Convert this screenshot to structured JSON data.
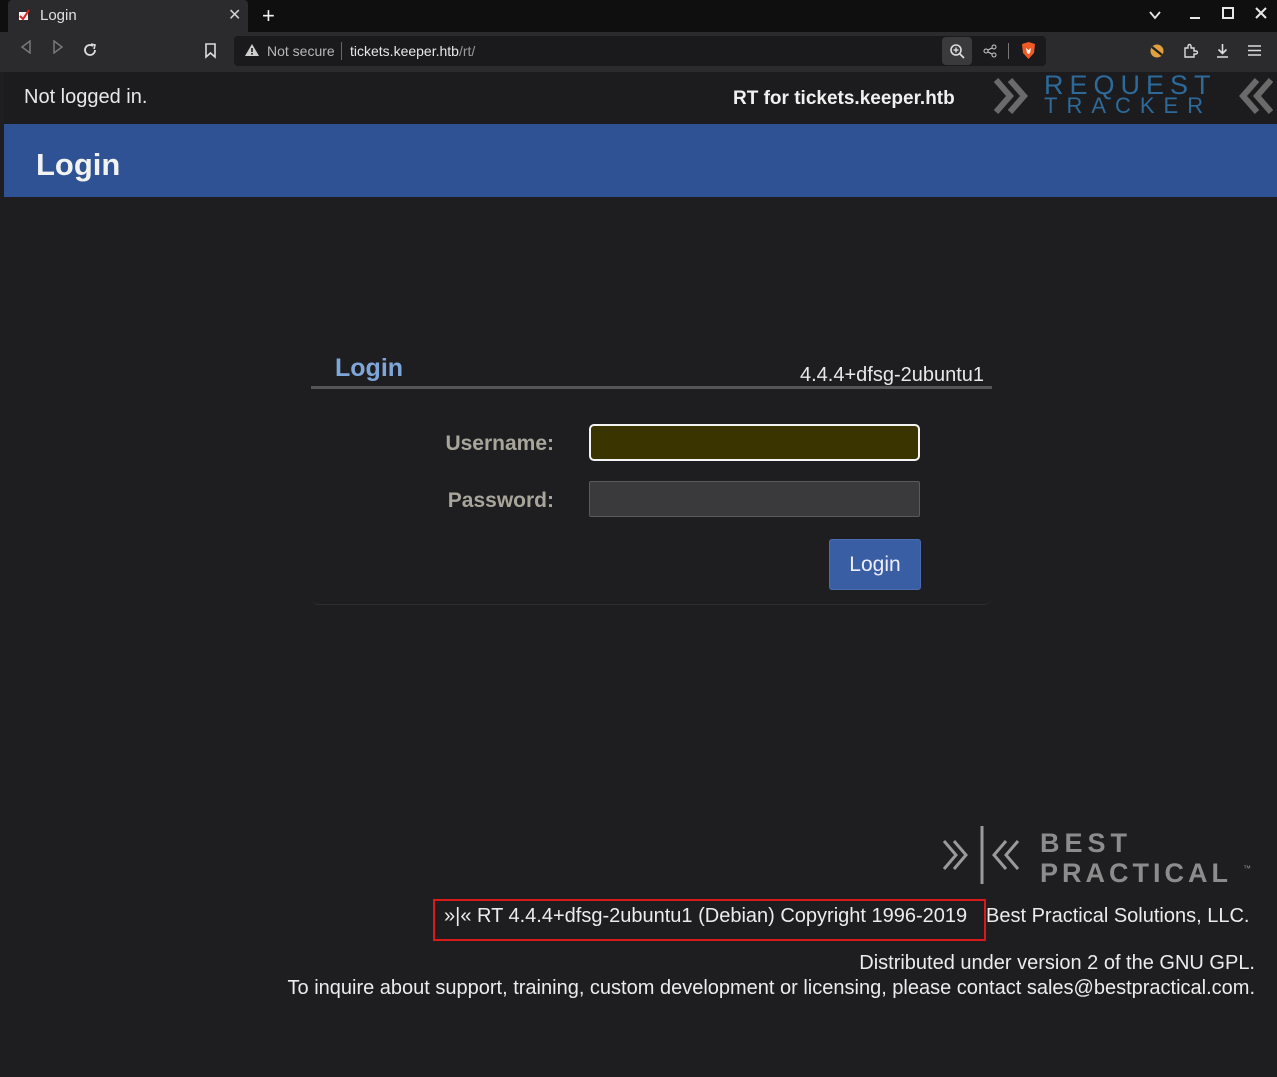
{
  "browser": {
    "tab_title": "Login",
    "close_glyph": "✕",
    "new_tab_glyph": "+",
    "not_secure": "Not secure",
    "url_host": "tickets.keeper.htb",
    "url_path": "/rt/"
  },
  "topbar": {
    "status": "Not logged in.",
    "rt_for": "RT for tickets.keeper.htb",
    "logo_line1": "REQUEST",
    "logo_line2": "TRACKER"
  },
  "header": {
    "title": "Login"
  },
  "login_box": {
    "title": "Login",
    "version": "4.4.4+dfsg-2ubuntu1",
    "username_label": "Username:",
    "password_label": "Password:",
    "username_value": "",
    "password_value": "",
    "submit_label": "Login"
  },
  "footer": {
    "bp_line1": "BEST",
    "bp_line2": "PRACTICAL",
    "bp_tm": "™",
    "copyright": "»|« RT 4.4.4+dfsg-2ubuntu1 (Debian) Copyright 1996-2019",
    "company": "Best Practical Solutions, LLC.",
    "license": "Distributed under version 2 of the GNU GPL.",
    "inquire": "To inquire about support, training, custom development or licensing, please contact sales@bestpractical.com."
  },
  "colors": {
    "header_bg": "#2e5293",
    "accent_title": "#7ea6d8",
    "username_bg": "#3a3500",
    "highlight_box": "#d81a1a"
  }
}
